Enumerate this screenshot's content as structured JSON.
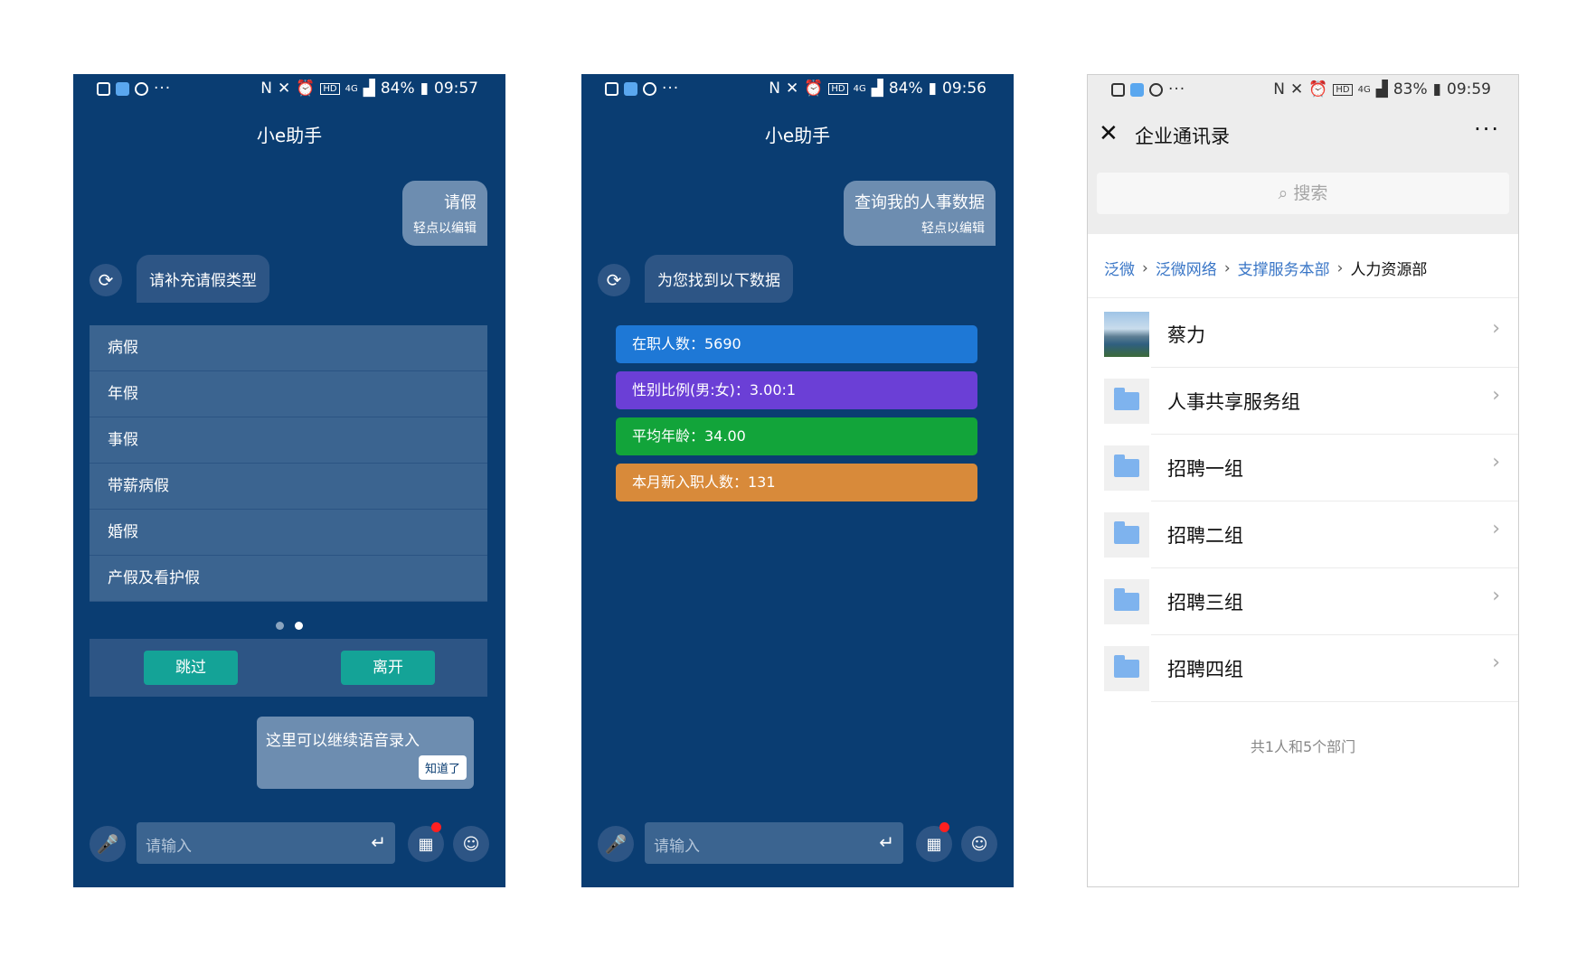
{
  "colors": {
    "dark_bg": "#0a3d72",
    "bubble_user": "#6d8db0",
    "bubble_bot": "#2d5585",
    "options_bg": "#3b6490",
    "button_teal": "#14a397",
    "accent_link": "#3875c6"
  },
  "screens": [
    {
      "status": {
        "battery": "84%",
        "time": "09:57",
        "net": "4G"
      },
      "title": "小e助手",
      "user_msg": {
        "text": "请假",
        "hint": "轻点以编辑"
      },
      "bot_msg": "请补充请假类型",
      "options": [
        "病假",
        "年假",
        "事假",
        "带薪病假",
        "婚假",
        "产假及看护假"
      ],
      "page": 2,
      "pages": 2,
      "skip_label": "跳过",
      "leave_label": "离开",
      "tooltip": {
        "text": "这里可以继续语音录入",
        "ok": "知道了"
      },
      "input_placeholder": "请输入"
    },
    {
      "status": {
        "battery": "84%",
        "time": "09:56",
        "net": "4G"
      },
      "title": "小e助手",
      "user_msg": {
        "text": "查询我的人事数据",
        "hint": "轻点以编辑"
      },
      "bot_msg": "为您找到以下数据",
      "data": [
        {
          "label": "在职人数：5690",
          "color": "#1e78d6"
        },
        {
          "label": "性别比例(男:女)：3.00:1",
          "color": "#6b3fd6"
        },
        {
          "label": "平均年龄：34.00",
          "color": "#12a43a"
        },
        {
          "label": "本月新入职人数：131",
          "color": "#d88a3a"
        }
      ],
      "input_placeholder": "请输入"
    },
    {
      "status": {
        "battery": "83%",
        "time": "09:59",
        "net": "4G"
      },
      "title": "企业通讯录",
      "search_placeholder": "搜索",
      "breadcrumb": [
        "泛微",
        "泛微网络",
        "支撑服务本部",
        "人力资源部"
      ],
      "items": [
        {
          "name": "蔡力",
          "type": "person"
        },
        {
          "name": "人事共享服务组",
          "type": "folder"
        },
        {
          "name": "招聘一组",
          "type": "folder"
        },
        {
          "name": "招聘二组",
          "type": "folder"
        },
        {
          "name": "招聘三组",
          "type": "folder"
        },
        {
          "name": "招聘四组",
          "type": "folder"
        }
      ],
      "footer": "共1人和5个部门"
    }
  ]
}
